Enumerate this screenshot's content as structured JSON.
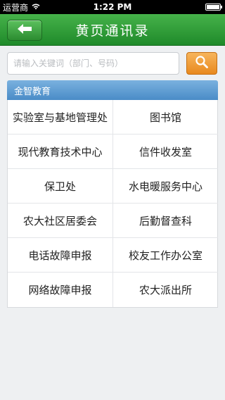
{
  "status_bar": {
    "carrier": "运营商",
    "time": "1:22 PM"
  },
  "nav": {
    "title": "黄页通讯录",
    "back_icon": "arrow-left-icon",
    "accent": "#2f9a36"
  },
  "search": {
    "placeholder": "请输入关键词（部门、号码）",
    "value": "",
    "button_icon": "search-icon",
    "button_color": "#f0a030"
  },
  "section": {
    "title": "金智教育",
    "header_color": "#5e9bd2"
  },
  "directory": [
    [
      "实验室与基地管理处",
      "图书馆"
    ],
    [
      "现代教育技术中心",
      "信件收发室"
    ],
    [
      "保卫处",
      "水电暖服务中心"
    ],
    [
      "农大社区居委会",
      "后勤督查科"
    ],
    [
      "电话故障申报",
      "校友工作办公室"
    ],
    [
      "网络故障申报",
      "农大派出所"
    ]
  ]
}
